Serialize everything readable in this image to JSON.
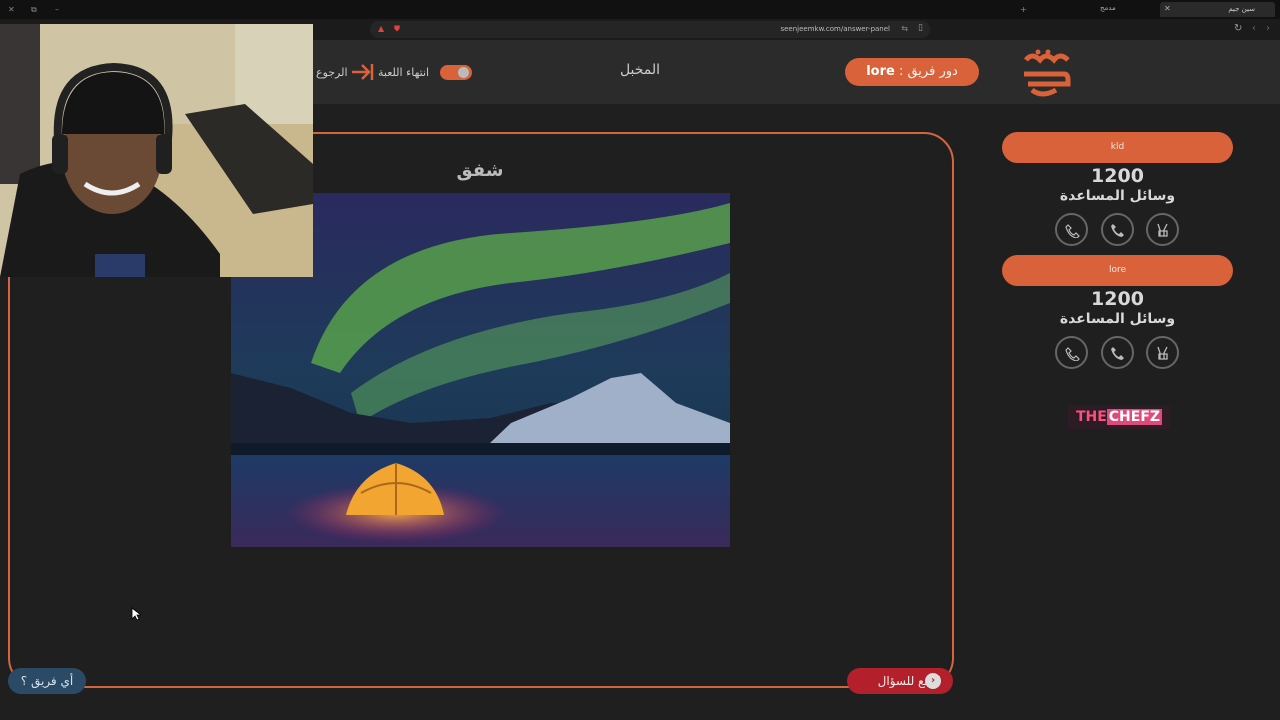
{
  "browser": {
    "tab_active": "سين جيم",
    "tab_inactive": "مدمج",
    "url": "seenjeemkw.com/answer-panel"
  },
  "header": {
    "turn_prefix": "دور فريق :",
    "turn_team": "lore",
    "category": "المخبل",
    "end_game_label": "انتهاء اللعبة",
    "back_label": "الرجوع"
  },
  "main": {
    "question": "شفق",
    "image_desc_icon": "aurora-tent-image",
    "back_to_question": "ارجع للسؤال",
    "which_team": "أي فريق ؟"
  },
  "teams": [
    {
      "name": "kld",
      "score": "1200",
      "helpers_label": "وسائل المساعدة"
    },
    {
      "name": "lore",
      "score": "1200",
      "helpers_label": "وسائل المساعدة"
    }
  ],
  "sponsor": {
    "part1": "THE",
    "part2": "CHEFZ"
  },
  "colors": {
    "accent": "#d9623a",
    "back_button": "#b3202b",
    "team_button": "#2a4a66"
  }
}
